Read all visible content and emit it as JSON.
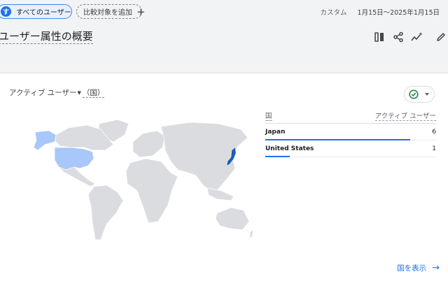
{
  "header": {
    "segment_chip": {
      "badge": "す",
      "label": "すべてのユーザー"
    },
    "compare_chip": {
      "label": "比較対象を追加",
      "icon": "plus-icon"
    },
    "date_range": {
      "preset": "カスタム",
      "range": "1月15日～2025年1月15日"
    }
  },
  "page": {
    "title": "ユーザー属性の概要",
    "tools": [
      "compare-columns-icon",
      "share-icon",
      "insights-icon",
      "edit-pencil-icon"
    ]
  },
  "card": {
    "metric": "アクティブ ユーザー",
    "dimension": "（国）",
    "status_icon": "check-circle-icon",
    "table": {
      "headers": {
        "dimension": "国",
        "metric": "アクティブ ユーザー"
      },
      "rows": [
        {
          "country": "Japan",
          "value": 6,
          "share": 1.0
        },
        {
          "country": "United States",
          "value": 1,
          "share": 0.167
        }
      ]
    },
    "view_link": "国を表示",
    "colors": {
      "japan": "#1a5fb4",
      "united_states": "#a8c7fa",
      "land": "#dadce0",
      "accent": "#1a73e8"
    }
  }
}
